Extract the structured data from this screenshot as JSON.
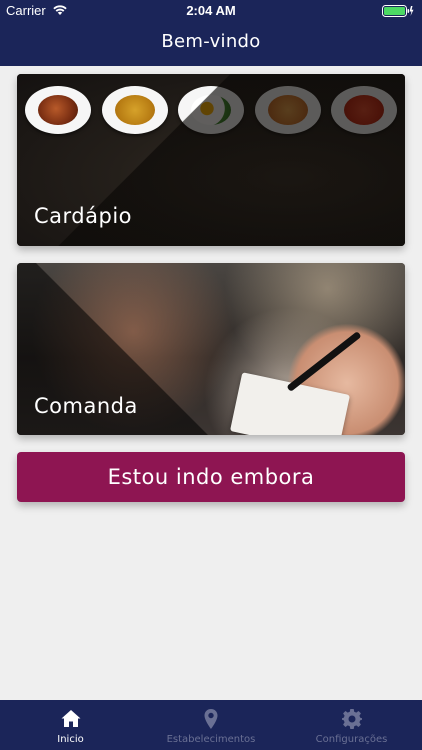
{
  "status_bar": {
    "carrier": "Carrier",
    "time": "2:04 AM"
  },
  "nav": {
    "title": "Bem-vindo"
  },
  "cards": {
    "menu_label": "Cardápio",
    "order_label": "Comanda"
  },
  "actions": {
    "leave_label": "Estou indo embora"
  },
  "tabs": [
    {
      "label": "Inicio",
      "icon": "home-icon",
      "active": true
    },
    {
      "label": "Estabelecimentos",
      "icon": "location-pin-icon",
      "active": false
    },
    {
      "label": "Configurações",
      "icon": "gear-icon",
      "active": false
    }
  ],
  "colors": {
    "header": "#1b2559",
    "accent_button": "#8e1552",
    "background": "#efefef",
    "tab_inactive": "#6a7094"
  }
}
